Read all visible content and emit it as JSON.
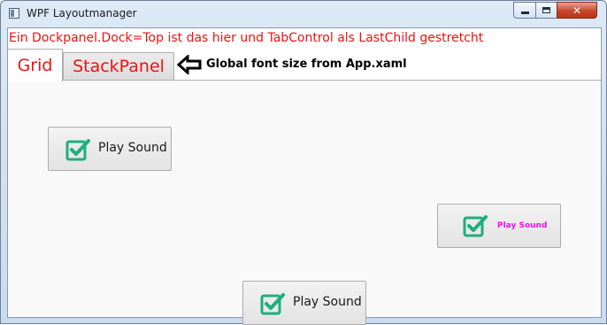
{
  "window": {
    "title": "WPF Layoutmanager",
    "caption_buttons": {
      "minimize_icon": "minimize-icon",
      "maximize_icon": "maximize-icon",
      "close_icon": "close-icon",
      "close_glyph": "✕"
    }
  },
  "dock_top_text": "Ein Dockpanel.Dock=Top ist das hier und TabControl als LastChild gestretcht",
  "tabs": [
    {
      "label": "Grid",
      "selected": true
    },
    {
      "label": "StackPanel",
      "selected": false
    }
  ],
  "annotation": {
    "icon": "arrow-left-icon",
    "text": "Global font size from App.xaml"
  },
  "buttons": [
    {
      "label": "Play Sound",
      "icon": "checkbox-checked-icon",
      "label_color": "#1a1a1a"
    },
    {
      "label": "Play Sound",
      "icon": "checkbox-checked-icon",
      "label_color": "#ee11ee"
    },
    {
      "label": "Play Sound",
      "icon": "checkbox-checked-icon",
      "label_color": "#1a1a1a"
    }
  ],
  "colors": {
    "red_text": "#ee1111",
    "check_green": "#1fae7d",
    "magenta_text": "#ee11ee"
  }
}
